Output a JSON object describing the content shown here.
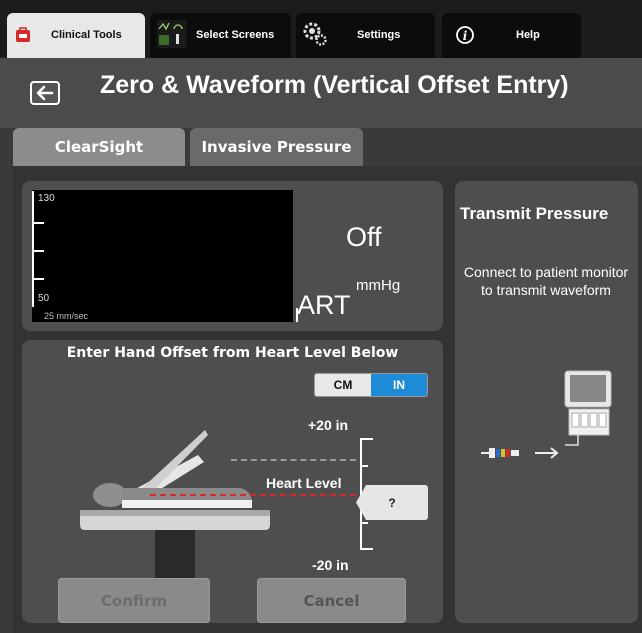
{
  "nav": {
    "tabs": [
      {
        "label": "Clinical Tools",
        "icon": "medical-kit-icon"
      },
      {
        "label": "Select Screens",
        "icon": "screens-icon"
      },
      {
        "label": "Settings",
        "icon": "gear-icon"
      },
      {
        "label": "Help",
        "icon": "info-icon"
      }
    ]
  },
  "header": {
    "title": "Zero & Waveform (Vertical Offset Entry)",
    "back_icon": "arrow-left-icon"
  },
  "mode_tabs": [
    "ClearSight",
    "Invasive Pressure"
  ],
  "waveform": {
    "scale_top": "130",
    "scale_bottom": "50",
    "sweep": "25 mm/sec",
    "value": "Off",
    "unit": "mmHg",
    "channel": "ART"
  },
  "transmit": {
    "title": "Transmit Pressure",
    "body": "Connect to patient monitor to transmit waveform"
  },
  "offset": {
    "title": "Enter Hand Offset from Heart Level Below",
    "unit_options": [
      "CM",
      "IN"
    ],
    "selected_unit": "IN",
    "scale_top": "+20 in",
    "scale_bottom": "-20 in",
    "heart_label": "Heart Level",
    "value_button": "?"
  },
  "actions": {
    "confirm": "Confirm",
    "cancel": "Cancel"
  },
  "colors": {
    "accent": "#1e8bd6",
    "heart_line": "#d42a2a"
  }
}
